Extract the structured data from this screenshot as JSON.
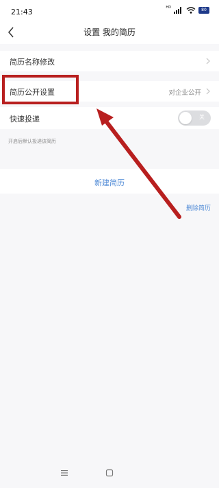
{
  "status": {
    "time": "21:43",
    "network_label": "HD",
    "battery": "80"
  },
  "nav": {
    "title": "设置 我的简历"
  },
  "settings": {
    "name_edit_label": "简历名称修改",
    "public_label": "简历公开设置",
    "public_value": "对企业公开",
    "quick_apply_label": "快速投递",
    "quick_apply_toggle": "关",
    "quick_apply_hint": "开启后默认投递该简历"
  },
  "actions": {
    "new_resume": "新建简历",
    "delete_resume": "删除简历"
  },
  "colors": {
    "accent": "#4f8ad6",
    "annotation": "#b81f1f",
    "toggle_off": "#dcdde0"
  },
  "icons": [
    "back-icon",
    "chevron-right-icon",
    "signal-icon",
    "wifi-icon",
    "battery-icon",
    "menu-icon",
    "home-icon"
  ]
}
